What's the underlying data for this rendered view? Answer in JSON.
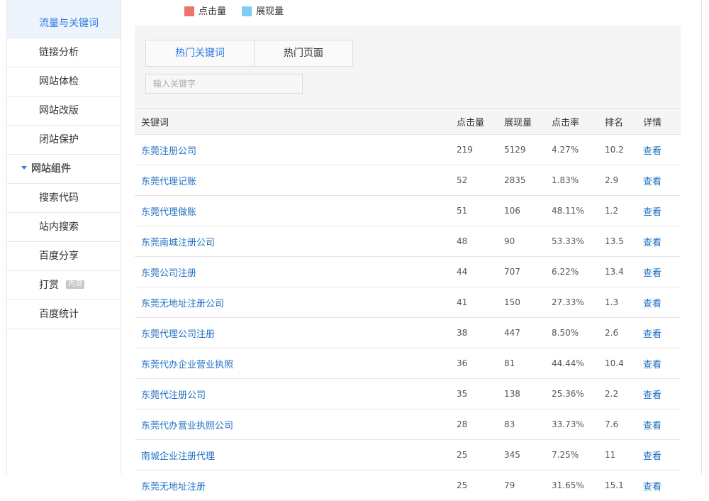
{
  "sidebar": {
    "items": [
      {
        "label": "流量与关键词",
        "active": true
      },
      {
        "label": "链接分析"
      },
      {
        "label": "网站体检"
      },
      {
        "label": "网站改版"
      },
      {
        "label": "闭站保护"
      }
    ],
    "group": {
      "label": "网站组件"
    },
    "group_items": [
      {
        "label": "搜索代码"
      },
      {
        "label": "站内搜索"
      },
      {
        "label": "百度分享"
      },
      {
        "label": "打赏",
        "badge": "内测"
      },
      {
        "label": "百度统计"
      }
    ]
  },
  "legend": {
    "items": [
      {
        "label": "点击量",
        "color": "#f0736b"
      },
      {
        "label": "展现量",
        "color": "#7dcdf7"
      }
    ]
  },
  "tabs": [
    {
      "label": "热门关键词",
      "active": true
    },
    {
      "label": "热门页面"
    }
  ],
  "search": {
    "placeholder": "输入关键字"
  },
  "table": {
    "headers": [
      "关键词",
      "点击量",
      "展现量",
      "点击率",
      "排名",
      "详情"
    ],
    "rows": [
      {
        "keyword": "东莞注册公司",
        "clicks": "219",
        "impressions": "5129",
        "ctr": "4.27%",
        "rank": "10.2",
        "action": "查看"
      },
      {
        "keyword": "东莞代理记账",
        "clicks": "52",
        "impressions": "2835",
        "ctr": "1.83%",
        "rank": "2.9",
        "action": "查看"
      },
      {
        "keyword": "东莞代理做账",
        "clicks": "51",
        "impressions": "106",
        "ctr": "48.11%",
        "rank": "1.2",
        "action": "查看"
      },
      {
        "keyword": "东莞南城注册公司",
        "clicks": "48",
        "impressions": "90",
        "ctr": "53.33%",
        "rank": "13.5",
        "action": "查看"
      },
      {
        "keyword": "东莞公司注册",
        "clicks": "44",
        "impressions": "707",
        "ctr": "6.22%",
        "rank": "13.4",
        "action": "查看"
      },
      {
        "keyword": "东莞无地址注册公司",
        "clicks": "41",
        "impressions": "150",
        "ctr": "27.33%",
        "rank": "1.3",
        "action": "查看"
      },
      {
        "keyword": "东莞代理公司注册",
        "clicks": "38",
        "impressions": "447",
        "ctr": "8.50%",
        "rank": "2.6",
        "action": "查看"
      },
      {
        "keyword": "东莞代办企业营业执照",
        "clicks": "36",
        "impressions": "81",
        "ctr": "44.44%",
        "rank": "10.4",
        "action": "查看"
      },
      {
        "keyword": "东莞代注册公司",
        "clicks": "35",
        "impressions": "138",
        "ctr": "25.36%",
        "rank": "2.2",
        "action": "查看"
      },
      {
        "keyword": "东莞代办营业执照公司",
        "clicks": "28",
        "impressions": "83",
        "ctr": "33.73%",
        "rank": "7.6",
        "action": "查看"
      },
      {
        "keyword": "南城企业注册代理",
        "clicks": "25",
        "impressions": "345",
        "ctr": "7.25%",
        "rank": "11",
        "action": "查看"
      },
      {
        "keyword": "东莞无地址注册",
        "clicks": "25",
        "impressions": "79",
        "ctr": "31.65%",
        "rank": "15.1",
        "action": "查看"
      }
    ]
  }
}
